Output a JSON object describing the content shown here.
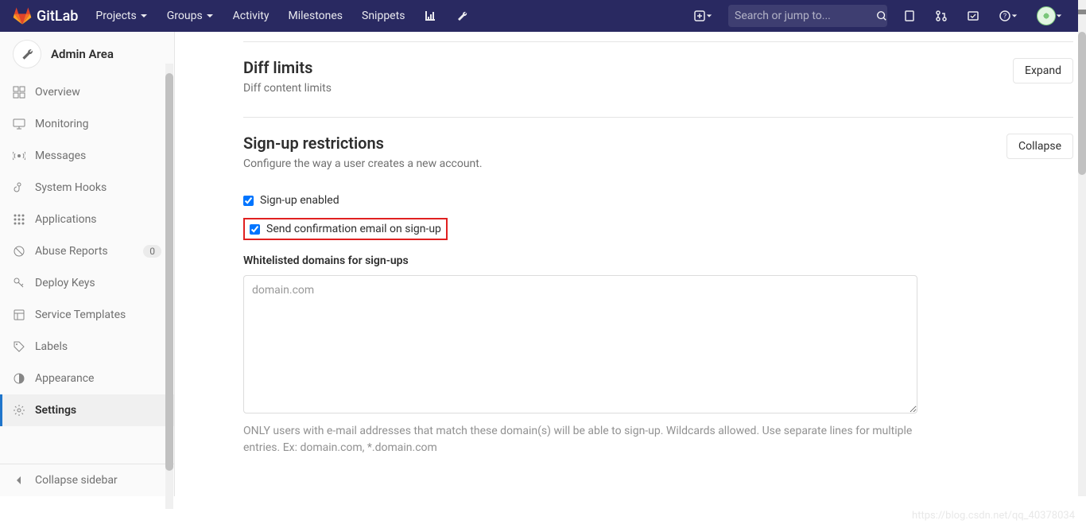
{
  "topbar": {
    "logo_text": "GitLab",
    "nav": {
      "projects": "Projects",
      "groups": "Groups",
      "activity": "Activity",
      "milestones": "Milestones",
      "snippets": "Snippets"
    },
    "search_placeholder": "Search or jump to..."
  },
  "sidebar": {
    "title": "Admin Area",
    "items": {
      "overview": "Overview",
      "monitoring": "Monitoring",
      "messages": "Messages",
      "system_hooks": "System Hooks",
      "applications": "Applications",
      "abuse_reports": "Abuse Reports",
      "abuse_reports_count": "0",
      "deploy_keys": "Deploy Keys",
      "service_templates": "Service Templates",
      "labels": "Labels",
      "appearance": "Appearance",
      "settings": "Settings"
    },
    "collapse": "Collapse sidebar"
  },
  "sections": {
    "diff_limits": {
      "title": "Diff limits",
      "desc": "Diff content limits",
      "button": "Expand"
    },
    "signup": {
      "title": "Sign-up restrictions",
      "desc": "Configure the way a user creates a new account.",
      "button": "Collapse",
      "signup_enabled_label": "Sign-up enabled",
      "send_confirmation_label": "Send confirmation email on sign-up",
      "whitelist_label": "Whitelisted domains for sign-ups",
      "whitelist_placeholder": "domain.com",
      "whitelist_help": "ONLY users with e-mail addresses that match these domain(s) will be able to sign-up. Wildcards allowed. Use separate lines for multiple entries. Ex: domain.com, *.domain.com"
    }
  },
  "watermark": "https://blog.csdn.net/qq_40378034"
}
